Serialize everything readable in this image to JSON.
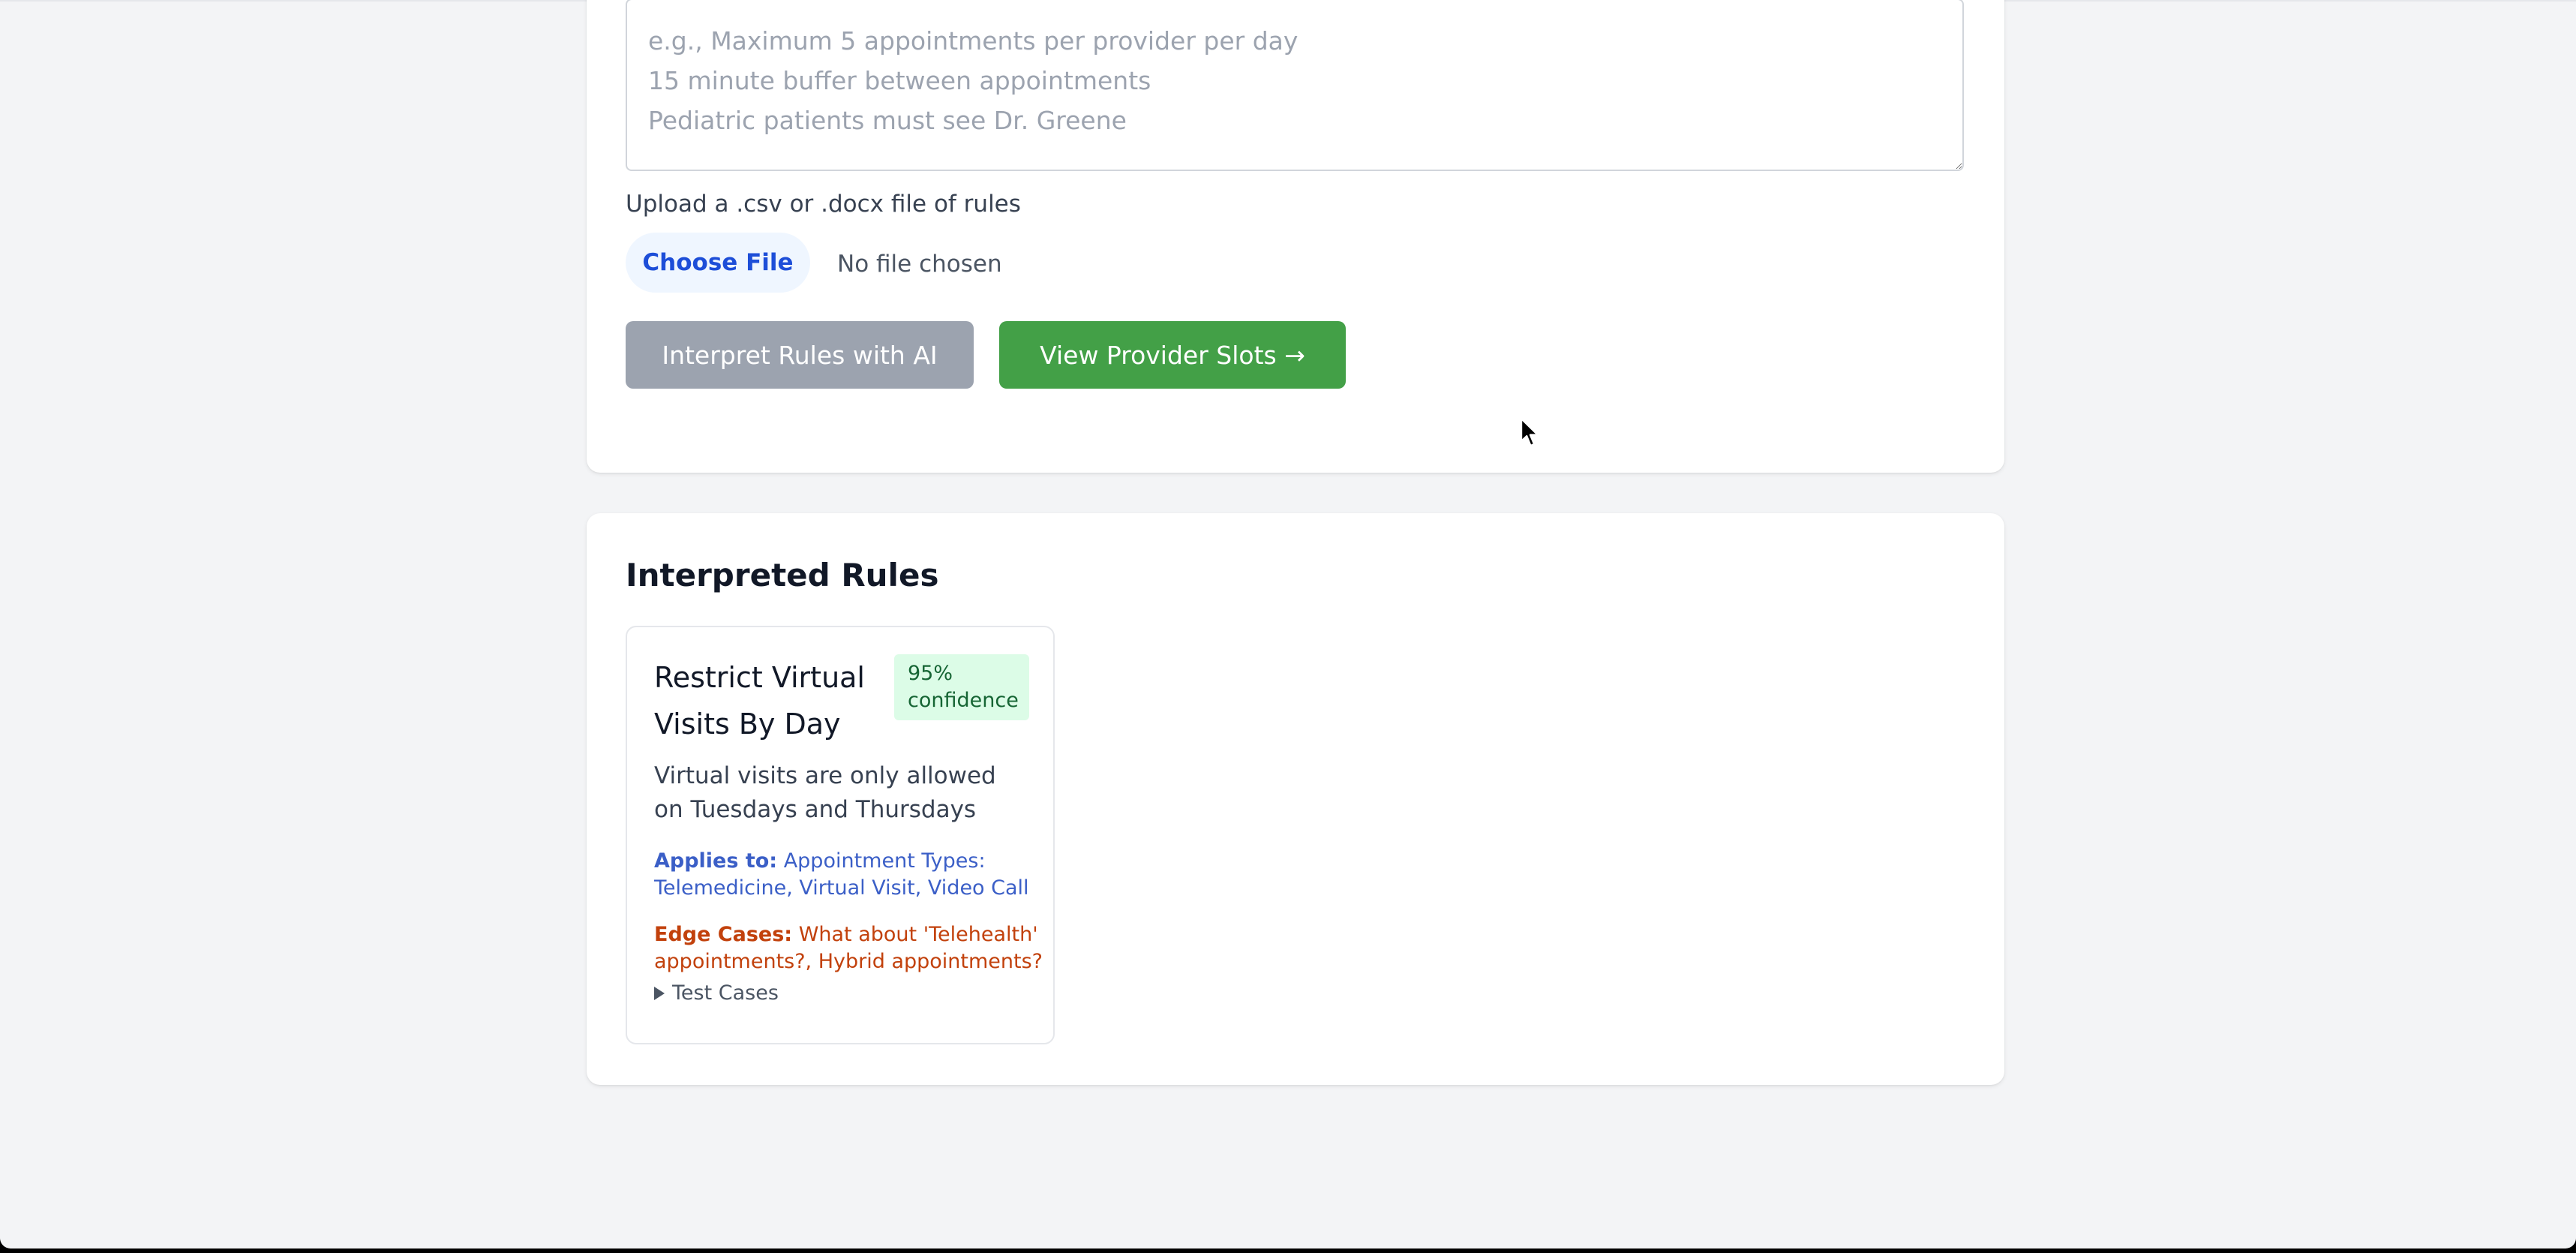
{
  "rules_input": {
    "placeholder": "e.g., Maximum 5 appointments per provider per day\n15 minute buffer between appointments\nPediatric patients must see Dr. Greene",
    "value": ""
  },
  "upload": {
    "label": "Upload a .csv or .docx file of rules",
    "button_label": "Choose File",
    "status": "No file chosen"
  },
  "actions": {
    "interpret_label": "Interpret Rules with AI",
    "slots_label": "View Provider Slots →"
  },
  "results": {
    "title": "Interpreted Rules",
    "rules": [
      {
        "name": "Restrict Virtual Visits By Day",
        "confidence": "95% confidence",
        "description": "Virtual visits are only allowed on Tuesdays and Thursdays",
        "applies_label": "Applies to:",
        "applies_value": "Appointment Types: Telemedicine, Virtual Visit, Video Call",
        "edge_label": "Edge Cases:",
        "edge_value": "What about 'Telehealth' appointments?, Hybrid appointments?",
        "test_cases_label": "Test Cases"
      }
    ]
  },
  "colors": {
    "page_background": "#f3f4f6",
    "primary_green": "#43a047",
    "disabled_gray": "#9ca3af",
    "applies_blue": "#3b5fc7",
    "edge_orange": "#c2410c",
    "confidence_bg": "#dcfce7"
  },
  "icons": {
    "disclosure": "triangle-right-icon",
    "pointer": "mouse-pointer-icon"
  }
}
